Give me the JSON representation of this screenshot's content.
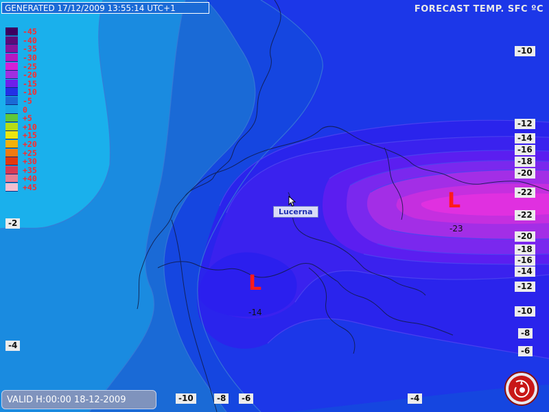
{
  "header": {
    "generated": "GENERATED 17/12/2009 13:55:14 UTC+1",
    "title": "FORECAST TEMP.  SFC   ºC"
  },
  "footer": {
    "valid": "VALID H:00:00  18-12-2009"
  },
  "legend": [
    {
      "label": "-45",
      "color": "#3c0060"
    },
    {
      "label": "-40",
      "color": "#5c0a7a"
    },
    {
      "label": "-35",
      "color": "#88139e"
    },
    {
      "label": "-30",
      "color": "#b418c2"
    },
    {
      "label": "-25",
      "color": "#d420d8"
    },
    {
      "label": "-20",
      "color": "#a030e0"
    },
    {
      "label": "-15",
      "color": "#6f1fea"
    },
    {
      "label": "-10",
      "color": "#2330e6"
    },
    {
      "label": "-5",
      "color": "#1a6ad6"
    },
    {
      "label": "0",
      "color": "#1aa6e6"
    },
    {
      "label": "+5",
      "color": "#5fc83a"
    },
    {
      "label": "+10",
      "color": "#b6dc14"
    },
    {
      "label": "+15",
      "color": "#ede60e"
    },
    {
      "label": "+20",
      "color": "#f5b10a"
    },
    {
      "label": "+25",
      "color": "#f07a10"
    },
    {
      "label": "+30",
      "color": "#e2380e"
    },
    {
      "label": "+35",
      "color": "#d93a55"
    },
    {
      "label": "+40",
      "color": "#e77e94"
    },
    {
      "label": "+45",
      "color": "#f4bfd0"
    }
  ],
  "isolines": [
    {
      "label": "-10"
    },
    {
      "label": "-12"
    },
    {
      "label": "-14"
    },
    {
      "label": "-16"
    },
    {
      "label": "-18"
    },
    {
      "label": "-20"
    },
    {
      "label": "-22"
    },
    {
      "label": "-22"
    },
    {
      "label": "-20"
    },
    {
      "label": "-18"
    },
    {
      "label": "-16"
    },
    {
      "label": "-14"
    },
    {
      "label": "-12"
    },
    {
      "label": "-10"
    },
    {
      "label": "-8"
    },
    {
      "label": "-6"
    },
    {
      "label": "-4"
    },
    {
      "label": "-6"
    },
    {
      "label": "-8"
    },
    {
      "label": "-10"
    },
    {
      "label": "-2"
    },
    {
      "label": "-4"
    }
  ],
  "city": "Lucerna",
  "lows": [
    {
      "letter": "L",
      "value": "-23"
    },
    {
      "letter": "L",
      "value": "-14"
    }
  ],
  "colors": {
    "background": "#1e4fe0",
    "accent_red": "#ff1a1a",
    "label_bg": "#ececec"
  }
}
